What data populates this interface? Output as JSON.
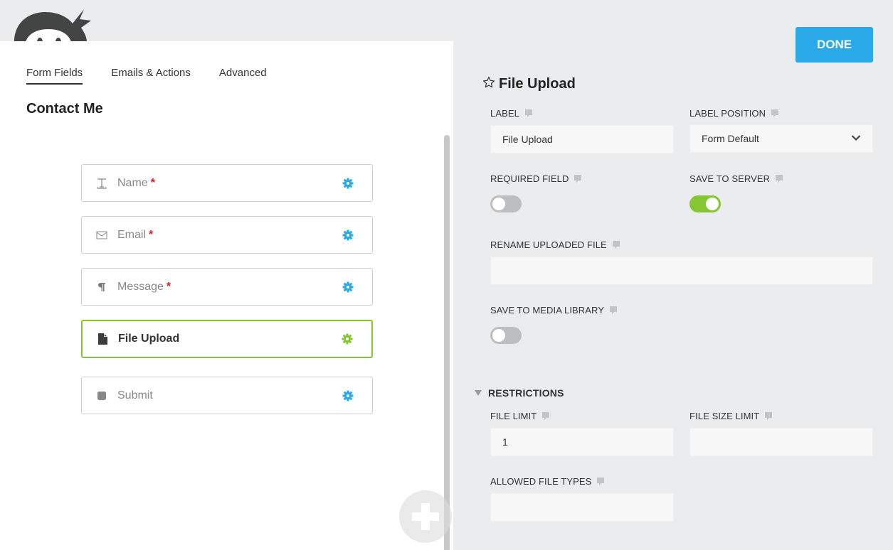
{
  "colors": {
    "accent_blue": "#2aa9e8",
    "accent_green": "#86c534",
    "required_red": "#e3141c",
    "toggle_off": "#bdbec0"
  },
  "logo": {
    "icon": "ninja-logo-icon"
  },
  "tabs": [
    {
      "label": "Form Fields",
      "active": true
    },
    {
      "label": "Emails & Actions",
      "active": false
    },
    {
      "label": "Advanced",
      "active": false
    }
  ],
  "form": {
    "title": "Contact Me",
    "fields": [
      {
        "label": "Name",
        "required": "*",
        "icon": "text-icon",
        "active": false
      },
      {
        "label": "Email",
        "required": "*",
        "icon": "envelope-icon",
        "active": false
      },
      {
        "label": "Message",
        "required": "*",
        "icon": "paragraph-icon",
        "active": false
      },
      {
        "label": "File Upload",
        "required": "",
        "icon": "file-icon",
        "active": true
      },
      {
        "label": "Submit",
        "required": "",
        "icon": "button-icon",
        "active": false
      }
    ],
    "add_button_icon": "plus-icon"
  },
  "settings": {
    "done_label": "DONE",
    "title": "File Upload",
    "title_icon": "star-outline-icon",
    "label": {
      "label": "LABEL",
      "value": "File Upload"
    },
    "label_position": {
      "label": "LABEL POSITION",
      "value": "Form Default"
    },
    "required_field": {
      "label": "REQUIRED FIELD",
      "on": false
    },
    "save_to_server": {
      "label": "SAVE TO SERVER",
      "on": true
    },
    "rename_uploaded_file": {
      "label": "RENAME UPLOADED FILE",
      "value": ""
    },
    "save_to_media_library": {
      "label": "SAVE TO MEDIA LIBRARY",
      "on": false
    },
    "restrictions": {
      "title": "RESTRICTIONS",
      "expanded": true,
      "file_limit": {
        "label": "FILE LIMIT",
        "value": "1"
      },
      "file_size_limit": {
        "label": "FILE SIZE LIMIT",
        "value": ""
      },
      "allowed_file_types": {
        "label": "ALLOWED FILE TYPES",
        "value": ""
      }
    }
  }
}
